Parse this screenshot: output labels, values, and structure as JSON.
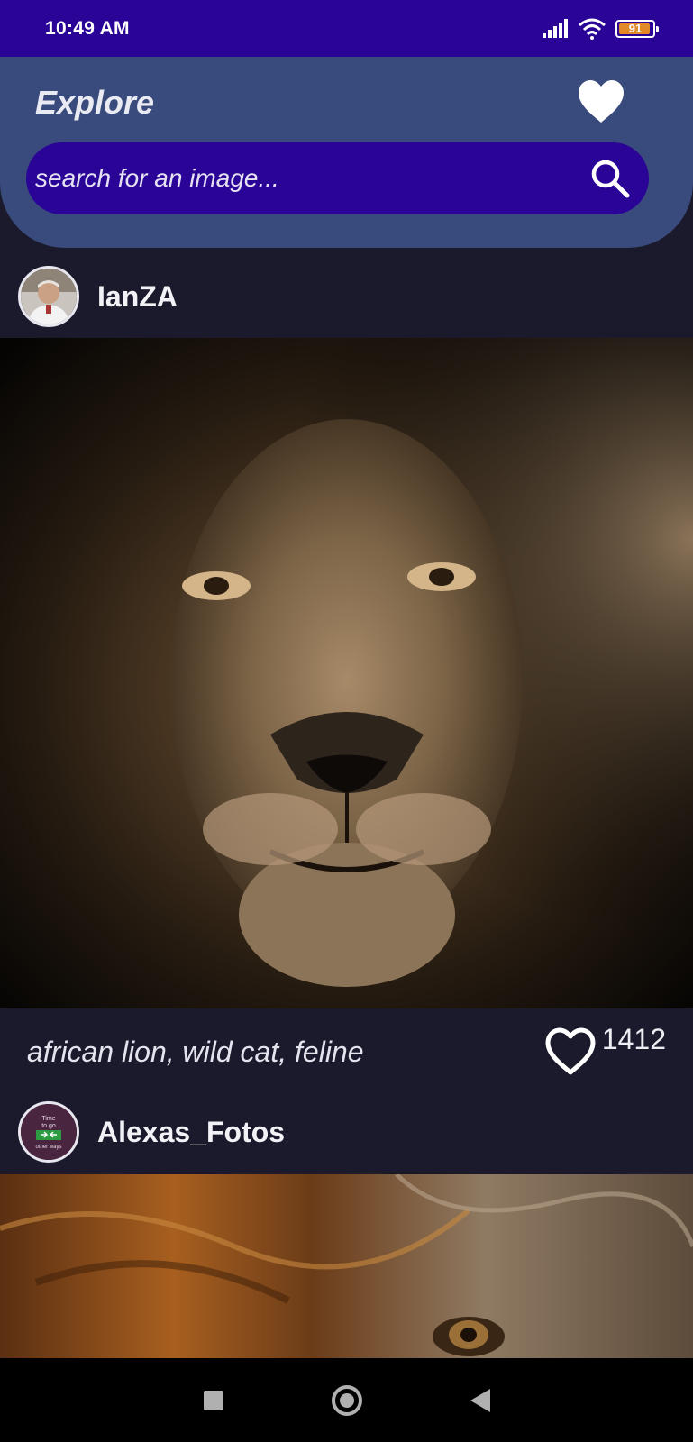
{
  "status_bar": {
    "time": "10:49 AM",
    "battery": "91",
    "icons": [
      "signal-icon",
      "wifi-icon",
      "battery-icon"
    ]
  },
  "header": {
    "title": "Explore",
    "favorites_icon": "heart-icon"
  },
  "search": {
    "placeholder": "search for an image...",
    "value": "",
    "icon": "search-icon"
  },
  "posts": [
    {
      "username": "IanZA",
      "image": "lion-portrait-dark",
      "tags": "african lion, wild cat, feline",
      "likes": "1412"
    },
    {
      "username": "Alexas_Fotos",
      "avatar_text": [
        "Time",
        "to go",
        "other ways"
      ],
      "image": "lion-closeup-golden-mane"
    }
  ],
  "nav_bar": {
    "icons": [
      "recents-square-icon",
      "home-circle-icon",
      "back-triangle-icon"
    ]
  },
  "colors": {
    "status_bar": "#2a0496",
    "header": "#394a7c",
    "search_field": "#2a0496",
    "background": "#1b1a2c",
    "nav_bar": "#000000"
  }
}
